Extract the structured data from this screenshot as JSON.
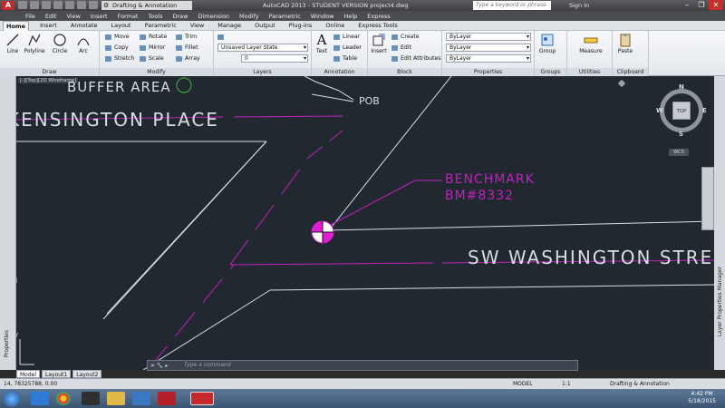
{
  "titlebar": {
    "workspace": "Drafting & Annotation",
    "title": "AutoCAD 2013 - STUDENT VERSION    project4.dwg",
    "search_placeholder": "Type a keyword or phrase",
    "signin": "Sign In"
  },
  "menu": [
    "File",
    "Edit",
    "View",
    "Insert",
    "Format",
    "Tools",
    "Draw",
    "Dimension",
    "Modify",
    "Parametric",
    "Window",
    "Help",
    "Express"
  ],
  "tabs": [
    "Home",
    "Insert",
    "Annotate",
    "Layout",
    "Parametric",
    "View",
    "Manage",
    "Output",
    "Plug-ins",
    "Online",
    "Express Tools"
  ],
  "ribbon": {
    "draw": {
      "title": "Draw",
      "line": "Line",
      "polyline": "Polyline",
      "circle": "Circle",
      "arc": "Arc"
    },
    "modify": {
      "title": "Modify",
      "move": "Move",
      "rotate": "Rotate",
      "trim": "Trim",
      "copy": "Copy",
      "mirror": "Mirror",
      "fillet": "Fillet",
      "stretch": "Stretch",
      "scale": "Scale",
      "array": "Array"
    },
    "layers": {
      "title": "Layers",
      "state": "Unsaved Layer State",
      "current": "0"
    },
    "annotation": {
      "title": "Annotation",
      "text": "Text",
      "linear": "Linear",
      "leader": "Leader",
      "table": "Table"
    },
    "block": {
      "title": "Block",
      "insert": "Insert",
      "create": "Create",
      "edit": "Edit",
      "edit_attributes": "Edit Attributes"
    },
    "properties": {
      "title": "Properties",
      "color": "ByLayer",
      "linetype": "ByLayer",
      "lineweight": "ByLayer"
    },
    "groups": {
      "title": "Groups",
      "group": "Group"
    },
    "utilities": {
      "title": "Utilities",
      "measure": "Measure"
    },
    "clipboard": {
      "title": "Clipboard",
      "paste": "Paste"
    }
  },
  "drawing": {
    "viewport_tag": "[-][Top][2D Wireframe]",
    "labels": {
      "buffer_area": "BUFFER AREA",
      "street1": "KENSINGTON PLACE",
      "pob": "POB",
      "benchmark": "BENCHMARK",
      "bm_number": "BM#8332",
      "street2": "SW WASHINGTON STRE"
    },
    "viewcube": {
      "top": "TOP",
      "n": "N",
      "s": "S",
      "e": "E",
      "w": "W",
      "wcs": "WCS"
    },
    "ucs": "Y",
    "side_palette": "Layer Properties Manager",
    "left_palette": "Properties"
  },
  "layout_tabs": [
    "Model",
    "Layout1",
    "Layout2"
  ],
  "command": {
    "placeholder": "Type a command"
  },
  "status": {
    "coords": "14, 78325788, 0.00",
    "model": "MODEL",
    "scale": "1:1",
    "workspace": "Drafting & Annotation"
  },
  "taskbar": {
    "time": "4:42 PM",
    "date": "5/18/2015"
  },
  "colors": {
    "background": "#212830",
    "magenta": "#c020c0",
    "lines": "#d8dde3"
  }
}
